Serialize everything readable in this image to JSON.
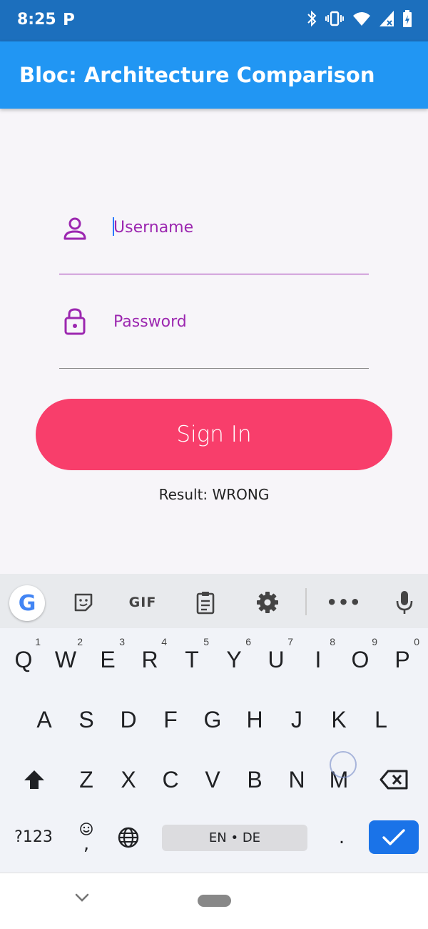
{
  "status_bar": {
    "time": "8:25",
    "app_icon_letter": "P",
    "icons": [
      "bluetooth-icon",
      "vibrate-icon",
      "wifi-icon",
      "signal-icon",
      "battery-icon"
    ]
  },
  "app_bar": {
    "title": "Bloc: Architecture Comparison ..."
  },
  "form": {
    "username": {
      "placeholder": "Username",
      "value": "",
      "icon": "person-icon",
      "underline_color": "#9c27b0"
    },
    "password": {
      "placeholder": "Password",
      "value": "",
      "icon": "lock-icon",
      "underline_color": "#888888"
    },
    "sign_in_label": "Sign In",
    "result_text": "Result: WRONG"
  },
  "colors": {
    "status_bar": "#1c6fbd",
    "app_bar": "#2196f3",
    "accent": "#9c27b0",
    "button": "#f83e6b",
    "enter_key": "#1a73e8"
  },
  "keyboard": {
    "toolbar": {
      "google_label": "G",
      "gif_label": "GIF",
      "icons": [
        "google-icon",
        "sticker-icon",
        "gif-icon",
        "clipboard-icon",
        "settings-icon",
        "more-icon",
        "mic-icon"
      ]
    },
    "row1": [
      {
        "key": "Q",
        "hint": "1"
      },
      {
        "key": "W",
        "hint": "2"
      },
      {
        "key": "E",
        "hint": "3"
      },
      {
        "key": "R",
        "hint": "4"
      },
      {
        "key": "T",
        "hint": "5"
      },
      {
        "key": "Y",
        "hint": "6"
      },
      {
        "key": "U",
        "hint": "7"
      },
      {
        "key": "I",
        "hint": "8"
      },
      {
        "key": "O",
        "hint": "9"
      },
      {
        "key": "P",
        "hint": "0"
      }
    ],
    "row2": [
      "A",
      "S",
      "D",
      "F",
      "G",
      "H",
      "J",
      "K",
      "L"
    ],
    "row3": [
      "Z",
      "X",
      "C",
      "V",
      "B",
      "N",
      "M"
    ],
    "bottom": {
      "symbols_label": "?123",
      "comma_label": ",",
      "space_label": "EN • DE",
      "period_label": "."
    }
  }
}
